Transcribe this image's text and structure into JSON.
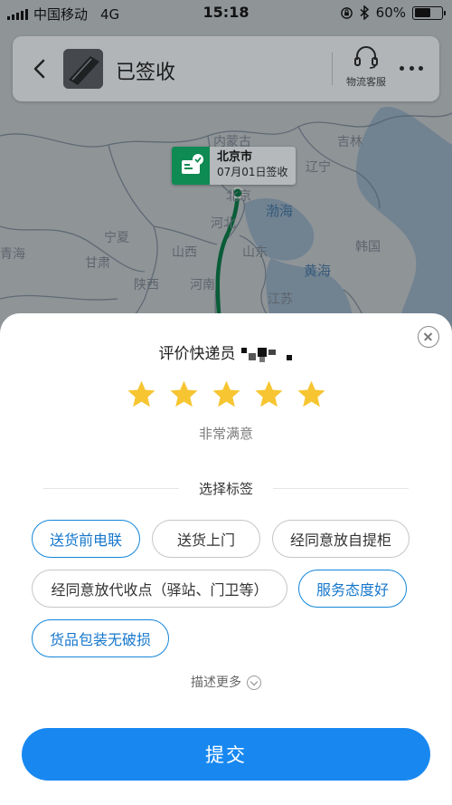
{
  "status_bar": {
    "carrier": "中国移动",
    "network": "4G",
    "time": "15:18",
    "battery_percent": "60%",
    "battery_level": 0.6,
    "icons": [
      "signal-icon",
      "rotation-lock-icon",
      "bluetooth-icon",
      "battery-icon"
    ]
  },
  "header": {
    "title": "已签收",
    "service_label": "物流客服",
    "icons": [
      "back-icon",
      "headset-icon",
      "more-icon"
    ]
  },
  "map": {
    "marker": {
      "city": "北京市",
      "date_status": "07月01日签收",
      "icon": "parcel-check-icon"
    },
    "labels": [
      "内蒙古",
      "吉林",
      "辽宁",
      "北京",
      "渤海",
      "河北",
      "宁夏",
      "山西",
      "山东",
      "韩国",
      "青海",
      "甘肃",
      "黄海",
      "陕西",
      "河南",
      "江苏"
    ],
    "route_color": "#0e8a53",
    "sea_color": "#a9c2d8"
  },
  "rating": {
    "title": "评价快递员",
    "stars_total": 5,
    "stars_selected": 5,
    "star_color": "#f6c531",
    "satisfaction": "非常满意"
  },
  "tags": {
    "section_title": "选择标签",
    "items": [
      {
        "label": "送货前电联",
        "selected": true
      },
      {
        "label": "送货上门",
        "selected": false
      },
      {
        "label": "经同意放自提柜",
        "selected": false
      },
      {
        "label": "经同意放代收点（驿站、门卫等）",
        "selected": false
      },
      {
        "label": "服务态度好",
        "selected": true
      },
      {
        "label": "货品包装无破损",
        "selected": true
      }
    ],
    "accent_color": "#1386d9"
  },
  "more_desc": "描述更多",
  "submit_label": "提交",
  "submit_color": "#1888f0"
}
